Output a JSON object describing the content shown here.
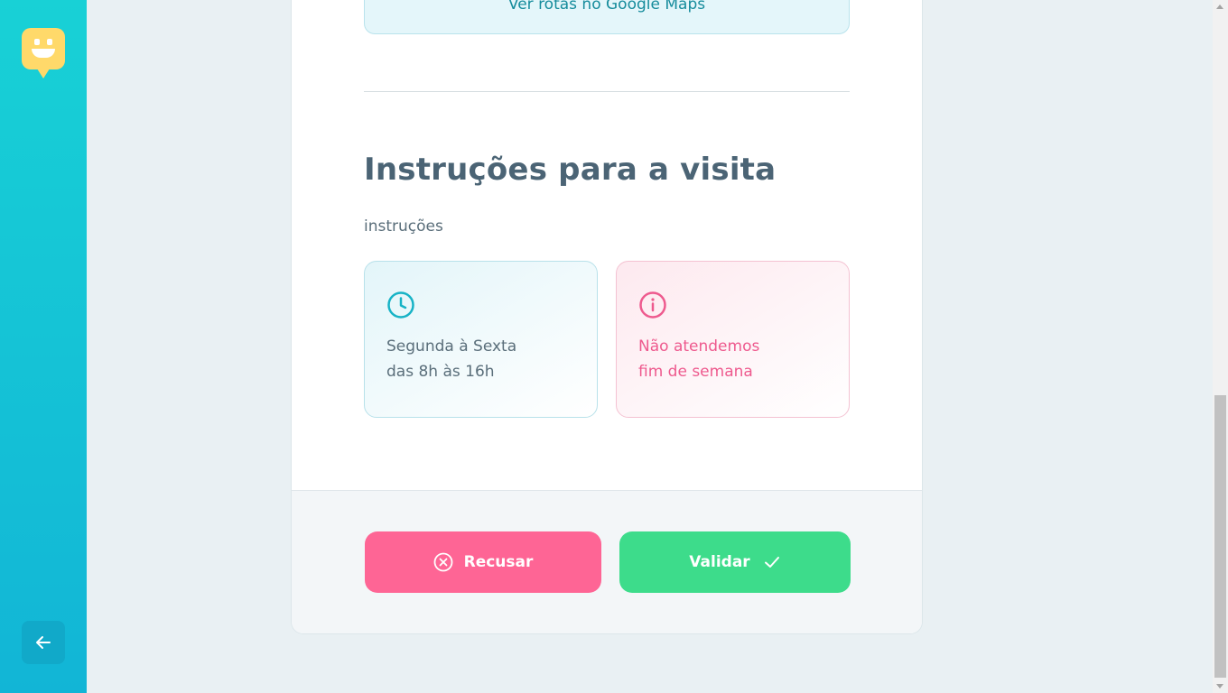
{
  "sidebar": {
    "logo_icon": "smiley-chat-icon",
    "back_icon": "arrow-left-icon"
  },
  "location": {
    "maps_link": "Ver rotas no Google Maps"
  },
  "instructions": {
    "title": "Instruções para a visita",
    "text": "instruções",
    "hours": {
      "icon": "clock-icon",
      "line1": "Segunda à Sexta",
      "line2": "das 8h às 16h"
    },
    "closed": {
      "icon": "info-icon",
      "line1": "Não atendemos",
      "line2": "fim de semana"
    }
  },
  "actions": {
    "refuse_label": "Recusar",
    "refuse_icon": "x-circle-icon",
    "validate_label": "Validar",
    "validate_icon": "check-icon"
  },
  "colors": {
    "accent": "#18d1d6",
    "refuse": "#fe6595",
    "validate": "#3ddc8b",
    "title": "#4b6475"
  }
}
